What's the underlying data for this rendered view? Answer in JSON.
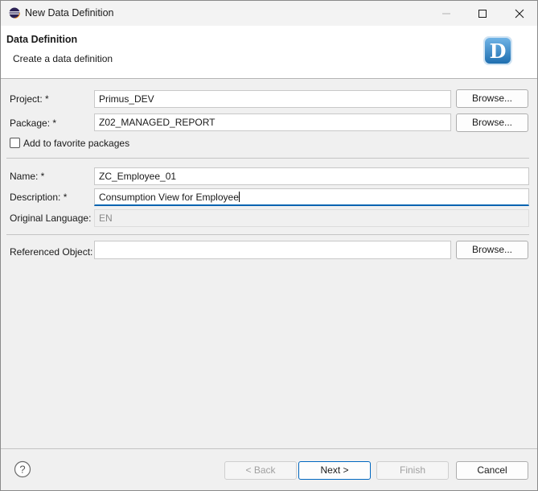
{
  "window": {
    "title": "New Data Definition"
  },
  "header": {
    "title": "Data Definition",
    "subtitle": "Create a data definition",
    "logo_letter": "D"
  },
  "form": {
    "project_label": "Project: *",
    "project_value": "Primus_DEV",
    "package_label": "Package: *",
    "package_value": "Z02_MANAGED_REPORT",
    "favorite_label": "Add to favorite packages",
    "favorite_checked": false,
    "name_label": "Name: *",
    "name_value": "ZC_Employee_01",
    "description_label": "Description: *",
    "description_value": "Consumption View for Employee",
    "language_label": "Original Language:",
    "language_value": "EN",
    "referenced_label": "Referenced Object:",
    "referenced_value": "",
    "browse_label": "Browse..."
  },
  "footer": {
    "back_label": "< Back",
    "next_label": "Next >",
    "finish_label": "Finish",
    "cancel_label": "Cancel"
  },
  "colors": {
    "accent": "#0063b1",
    "logo_blue": "#2d86c9"
  }
}
